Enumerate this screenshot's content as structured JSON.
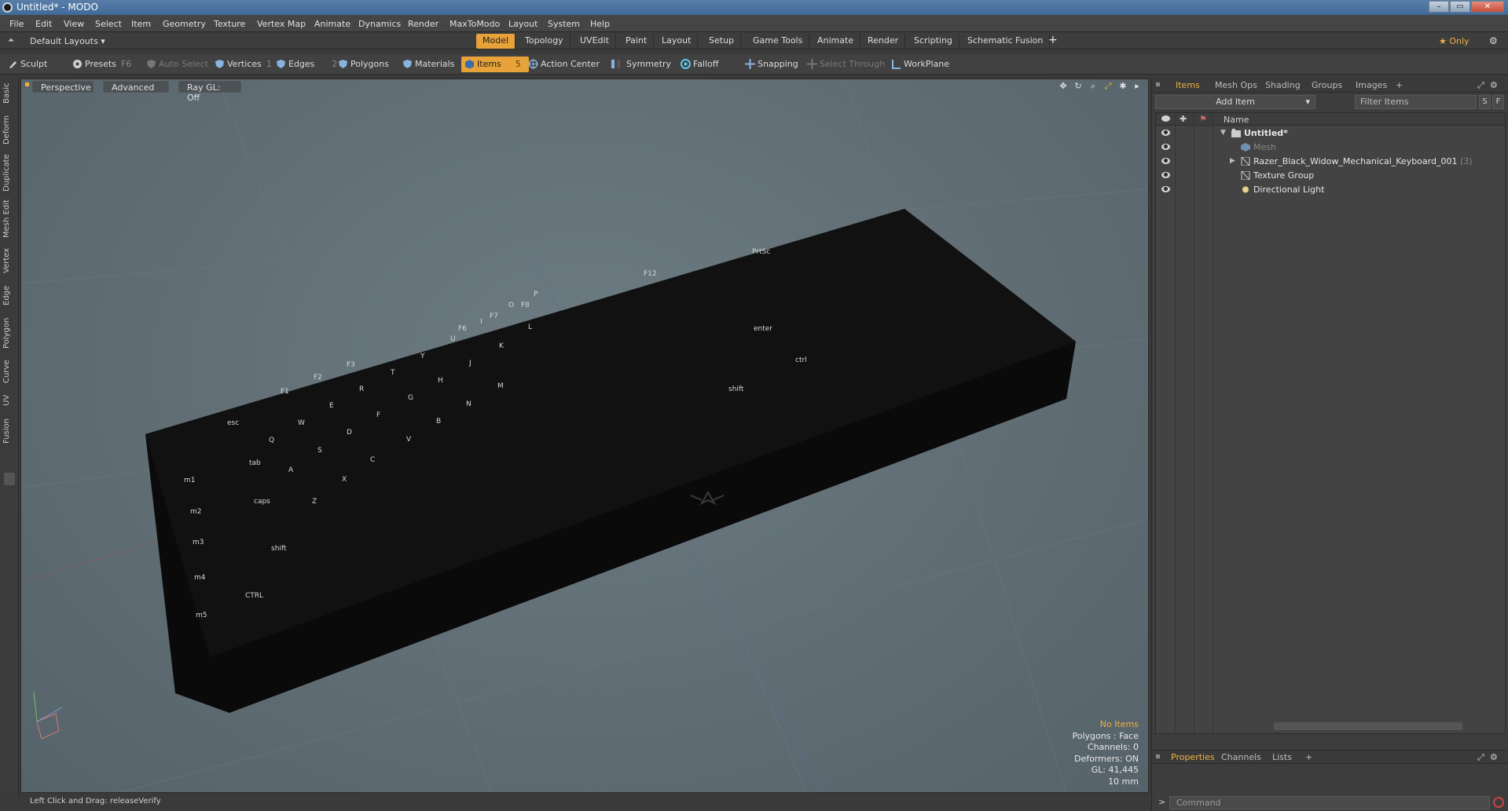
{
  "window": {
    "title": "Untitled* - MODO",
    "controls": [
      "–",
      "▭",
      "✕"
    ]
  },
  "menubar": [
    "File",
    "Edit",
    "View",
    "Select",
    "Item",
    "Geometry",
    "Texture",
    "Vertex Map",
    "Animate",
    "Dynamics",
    "Render",
    "MaxToModo",
    "Layout",
    "System",
    "Help"
  ],
  "layoutbar": {
    "layouts_label": "Default Layouts ▾",
    "tabs": [
      "Model",
      "Topology",
      "UVEdit",
      "Paint",
      "Layout",
      "Setup",
      "Game Tools",
      "Animate",
      "Render",
      "Scripting",
      "Schematic Fusion"
    ],
    "active_tab": "Model",
    "add": "+",
    "only_label": "★ Only"
  },
  "toolbar": {
    "sculpt": "Sculpt",
    "presets": "Presets",
    "presets_key": "F6",
    "auto_select": "Auto Select",
    "vertices": "Vertices",
    "vertices_key": "1",
    "edges": "Edges",
    "edges_key": "2",
    "polygons": "Polygons",
    "materials": "Materials",
    "items": "Items",
    "items_key": "5",
    "action_center": "Action Center",
    "symmetry": "Symmetry",
    "falloff": "Falloff",
    "snapping": "Snapping",
    "select_through": "Select Through",
    "workplane": "WorkPlane"
  },
  "left_tabs": [
    "Basic",
    "Deform",
    "Duplicate",
    "Mesh Edit",
    "Vertex",
    "Edge",
    "Polygon",
    "Curve",
    "UV",
    "Fusion"
  ],
  "viewport": {
    "perspective": "Perspective",
    "advanced": "Advanced",
    "raygl": "Ray GL: Off",
    "stats": {
      "items": "No Items",
      "polygons": "Polygons : Face",
      "channels": "Channels: 0",
      "deformers": "Deformers: ON",
      "gl": "GL: 41,445",
      "scale": "10 mm"
    }
  },
  "statusbar": {
    "text": "Left Click and Drag:   releaseVerify"
  },
  "right_panel": {
    "tabs": [
      "Items",
      "Mesh Ops",
      "Shading",
      "Groups",
      "Images",
      "+"
    ],
    "active_tab": "Items",
    "add_item": "Add Item",
    "filter_placeholder": "Filter Items",
    "s_btn": "S",
    "f_btn": "F",
    "column_name": "Name",
    "items": [
      {
        "label": "Untitled*",
        "count": ""
      },
      {
        "label": "Mesh",
        "count": ""
      },
      {
        "label": "Razer_Black_Widow_Mechanical_Keyboard_001",
        "count": "(3)"
      },
      {
        "label": "Texture Group",
        "count": ""
      },
      {
        "label": "Directional Light",
        "count": ""
      }
    ],
    "prop_tabs": [
      "Properties",
      "Channels",
      "Lists",
      "+"
    ],
    "command_placeholder": "Command"
  },
  "colors": {
    "accent": "#e8a23a",
    "viewport_bg": "#5f6c73",
    "panel_bg": "#3d3d3d",
    "keyboard": "#080808"
  }
}
